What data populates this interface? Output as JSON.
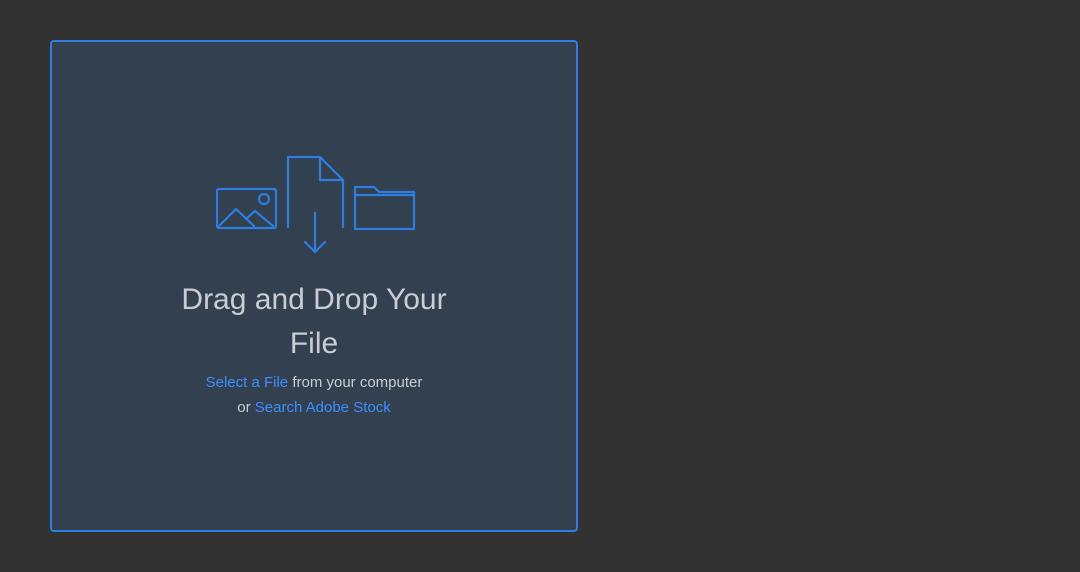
{
  "dropzone": {
    "title_line1": "Drag and Drop Your",
    "title_line2": "File",
    "select_link": "Select a File",
    "select_suffix": " from your computer",
    "or_prefix": "or ",
    "stock_link": "Search Adobe Stock"
  },
  "colors": {
    "accent": "#2d7ee0",
    "link": "#3d8eff",
    "panel_bg": "#33404f",
    "page_bg": "#323232",
    "text": "#c9cdd3"
  },
  "icons": [
    "image-icon",
    "file-download-icon",
    "folder-icon"
  ]
}
